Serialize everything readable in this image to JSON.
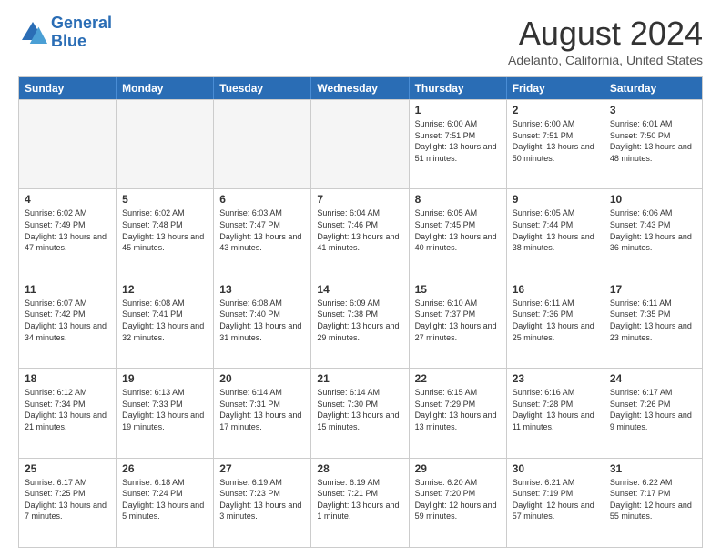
{
  "logo": {
    "line1": "General",
    "line2": "Blue"
  },
  "title": "August 2024",
  "location": "Adelanto, California, United States",
  "days_of_week": [
    "Sunday",
    "Monday",
    "Tuesday",
    "Wednesday",
    "Thursday",
    "Friday",
    "Saturday"
  ],
  "weeks": [
    [
      {
        "day": "",
        "empty": true
      },
      {
        "day": "",
        "empty": true
      },
      {
        "day": "",
        "empty": true
      },
      {
        "day": "",
        "empty": true
      },
      {
        "day": "1",
        "rise": "6:00 AM",
        "set": "7:51 PM",
        "daylight": "13 hours and 51 minutes."
      },
      {
        "day": "2",
        "rise": "6:00 AM",
        "set": "7:51 PM",
        "daylight": "13 hours and 50 minutes."
      },
      {
        "day": "3",
        "rise": "6:01 AM",
        "set": "7:50 PM",
        "daylight": "13 hours and 48 minutes."
      }
    ],
    [
      {
        "day": "4",
        "rise": "6:02 AM",
        "set": "7:49 PM",
        "daylight": "13 hours and 47 minutes."
      },
      {
        "day": "5",
        "rise": "6:02 AM",
        "set": "7:48 PM",
        "daylight": "13 hours and 45 minutes."
      },
      {
        "day": "6",
        "rise": "6:03 AM",
        "set": "7:47 PM",
        "daylight": "13 hours and 43 minutes."
      },
      {
        "day": "7",
        "rise": "6:04 AM",
        "set": "7:46 PM",
        "daylight": "13 hours and 41 minutes."
      },
      {
        "day": "8",
        "rise": "6:05 AM",
        "set": "7:45 PM",
        "daylight": "13 hours and 40 minutes."
      },
      {
        "day": "9",
        "rise": "6:05 AM",
        "set": "7:44 PM",
        "daylight": "13 hours and 38 minutes."
      },
      {
        "day": "10",
        "rise": "6:06 AM",
        "set": "7:43 PM",
        "daylight": "13 hours and 36 minutes."
      }
    ],
    [
      {
        "day": "11",
        "rise": "6:07 AM",
        "set": "7:42 PM",
        "daylight": "13 hours and 34 minutes."
      },
      {
        "day": "12",
        "rise": "6:08 AM",
        "set": "7:41 PM",
        "daylight": "13 hours and 32 minutes."
      },
      {
        "day": "13",
        "rise": "6:08 AM",
        "set": "7:40 PM",
        "daylight": "13 hours and 31 minutes."
      },
      {
        "day": "14",
        "rise": "6:09 AM",
        "set": "7:38 PM",
        "daylight": "13 hours and 29 minutes."
      },
      {
        "day": "15",
        "rise": "6:10 AM",
        "set": "7:37 PM",
        "daylight": "13 hours and 27 minutes."
      },
      {
        "day": "16",
        "rise": "6:11 AM",
        "set": "7:36 PM",
        "daylight": "13 hours and 25 minutes."
      },
      {
        "day": "17",
        "rise": "6:11 AM",
        "set": "7:35 PM",
        "daylight": "13 hours and 23 minutes."
      }
    ],
    [
      {
        "day": "18",
        "rise": "6:12 AM",
        "set": "7:34 PM",
        "daylight": "13 hours and 21 minutes."
      },
      {
        "day": "19",
        "rise": "6:13 AM",
        "set": "7:33 PM",
        "daylight": "13 hours and 19 minutes."
      },
      {
        "day": "20",
        "rise": "6:14 AM",
        "set": "7:31 PM",
        "daylight": "13 hours and 17 minutes."
      },
      {
        "day": "21",
        "rise": "6:14 AM",
        "set": "7:30 PM",
        "daylight": "13 hours and 15 minutes."
      },
      {
        "day": "22",
        "rise": "6:15 AM",
        "set": "7:29 PM",
        "daylight": "13 hours and 13 minutes."
      },
      {
        "day": "23",
        "rise": "6:16 AM",
        "set": "7:28 PM",
        "daylight": "13 hours and 11 minutes."
      },
      {
        "day": "24",
        "rise": "6:17 AM",
        "set": "7:26 PM",
        "daylight": "13 hours and 9 minutes."
      }
    ],
    [
      {
        "day": "25",
        "rise": "6:17 AM",
        "set": "7:25 PM",
        "daylight": "13 hours and 7 minutes."
      },
      {
        "day": "26",
        "rise": "6:18 AM",
        "set": "7:24 PM",
        "daylight": "13 hours and 5 minutes."
      },
      {
        "day": "27",
        "rise": "6:19 AM",
        "set": "7:23 PM",
        "daylight": "13 hours and 3 minutes."
      },
      {
        "day": "28",
        "rise": "6:19 AM",
        "set": "7:21 PM",
        "daylight": "13 hours and 1 minute."
      },
      {
        "day": "29",
        "rise": "6:20 AM",
        "set": "7:20 PM",
        "daylight": "12 hours and 59 minutes."
      },
      {
        "day": "30",
        "rise": "6:21 AM",
        "set": "7:19 PM",
        "daylight": "12 hours and 57 minutes."
      },
      {
        "day": "31",
        "rise": "6:22 AM",
        "set": "7:17 PM",
        "daylight": "12 hours and 55 minutes."
      }
    ]
  ]
}
